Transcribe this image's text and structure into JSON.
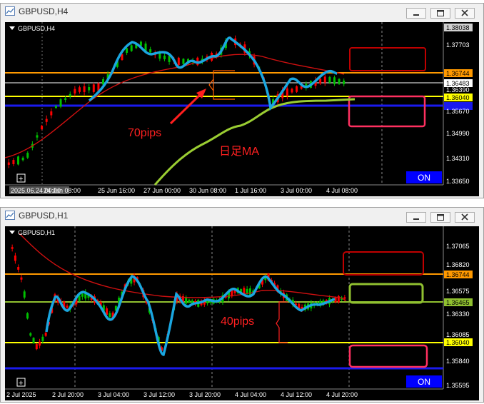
{
  "top_window": {
    "title": "GBPUSD,H4",
    "chart_label": "GBPUSD,H4",
    "price_axis": [
      "1.38038",
      "1.37703",
      "1.36744",
      "1.36483",
      "1.36390",
      "1.36040",
      "1.35670",
      "1.34990",
      "1.34310",
      "1.33650"
    ],
    "time_axis": [
      "2025.06.24 00:00",
      "24 Jun 08:00",
      "25 Jun 16:00",
      "27 Jun 00:00",
      "30 Jun 08:00",
      "1 Jul 16:00",
      "3 Jul 00:00",
      "4 Jul 08:00"
    ],
    "annotation_pips": "70pips",
    "annotation_ma": "日足MA",
    "on_label": "ON",
    "plus_label": "+"
  },
  "bottom_window": {
    "title": "GBPUSD,H1",
    "chart_label": "GBPUSD,H1",
    "price_axis": [
      "1.37065",
      "1.36820",
      "1.36744",
      "1.36575",
      "1.36465",
      "1.36330",
      "1.36085",
      "1.36040",
      "1.35840",
      "1.35595"
    ],
    "time_axis": [
      "2 Jul 2025",
      "2 Jul 20:00",
      "3 Jul 04:00",
      "3 Jul 12:00",
      "3 Jul 20:00",
      "4 Jul 04:00",
      "4 Jul 12:00",
      "4 Jul 20:00"
    ],
    "annotation_pips": "40pips",
    "on_label": "ON",
    "plus_label": "+"
  },
  "colors": {
    "background": "#000000",
    "bull_candle": "#00c000",
    "bear_candle": "#ff0000",
    "price_line_blue": "#1aa6e0",
    "ma_red": "#d01010",
    "ma_daily_green": "#9acd32",
    "level_orange": "#ff9900",
    "level_yellow": "#ffff00",
    "level_blue": "#0000dd",
    "level_green": "#90c030",
    "box_red": "#c00000",
    "box_pink": "#ff3060",
    "on_button": "#0000ff",
    "annotation_red": "#ff2020"
  }
}
